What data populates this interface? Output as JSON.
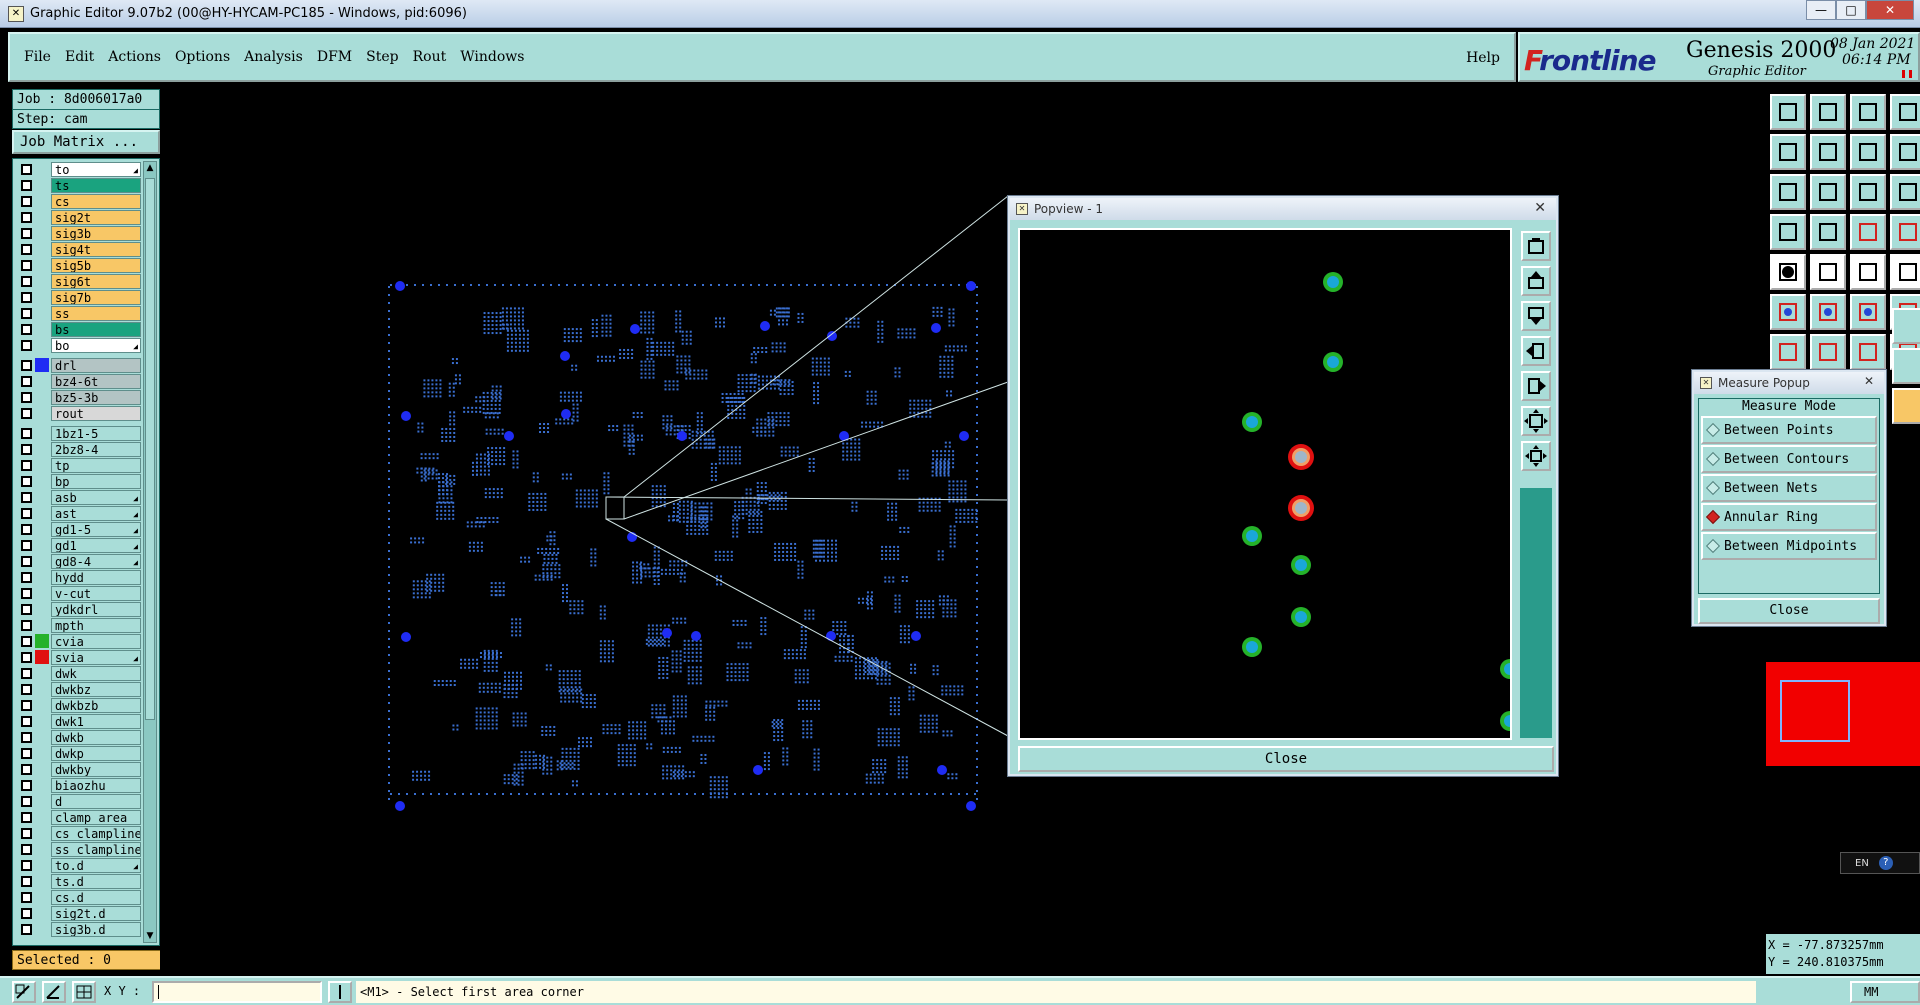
{
  "window": {
    "title": "Graphic Editor 9.07b2 (00@HY-HYCAM-PC185 - Windows, pid:6096)",
    "minimize": "—",
    "maximize": "□",
    "close": "✕"
  },
  "menu": {
    "items": [
      "File",
      "Edit",
      "Actions",
      "Options",
      "Analysis",
      "DFM",
      "Step",
      "Rout",
      "Windows"
    ],
    "help": "Help"
  },
  "brand": {
    "logo_f": "F",
    "logo_rest": "rontline",
    "product": "Genesis 2000",
    "subtitle": "Graphic Editor",
    "date": "08 Jan 2021",
    "time": "06:14 PM"
  },
  "job": {
    "job_label": "Job : 8d006017a0",
    "step_label": "Step: cam",
    "matrix_button": "Job Matrix ..."
  },
  "layers": {
    "group1": [
      {
        "name": "to",
        "color": "#ffffff",
        "mark": true
      },
      {
        "name": "ts",
        "color": "#1aa37f",
        "mark": false
      },
      {
        "name": "cs",
        "color": "#f8c766",
        "mark": false
      },
      {
        "name": "sig2t",
        "color": "#f8c766",
        "mark": false
      },
      {
        "name": "sig3b",
        "color": "#f8c766",
        "mark": false
      },
      {
        "name": "sig4t",
        "color": "#f8c766",
        "mark": false
      },
      {
        "name": "sig5b",
        "color": "#f8c766",
        "mark": false
      },
      {
        "name": "sig6t",
        "color": "#f8c766",
        "mark": false
      },
      {
        "name": "sig7b",
        "color": "#f8c766",
        "mark": false
      },
      {
        "name": "ss",
        "color": "#f8c766",
        "mark": false
      },
      {
        "name": "bs",
        "color": "#1aa37f",
        "mark": false
      },
      {
        "name": "bo",
        "color": "#ffffff",
        "mark": true
      }
    ],
    "group2": [
      {
        "name": "drl",
        "color": "#b3c4c4",
        "swatch": "#1f2cf4"
      },
      {
        "name": "bz4-6t",
        "color": "#b3c4c4",
        "swatch": ""
      },
      {
        "name": "bz5-3b",
        "color": "#b3c4c4",
        "swatch": ""
      },
      {
        "name": "rout",
        "color": "#d8d8d8",
        "swatch": ""
      }
    ],
    "group3": [
      {
        "name": "1bz1-5",
        "mark": false,
        "swatch": ""
      },
      {
        "name": "2bz8-4",
        "mark": false,
        "swatch": ""
      },
      {
        "name": "tp",
        "mark": false,
        "swatch": ""
      },
      {
        "name": "bp",
        "mark": false,
        "swatch": ""
      },
      {
        "name": "asb",
        "mark": true,
        "swatch": ""
      },
      {
        "name": "ast",
        "mark": true,
        "swatch": ""
      },
      {
        "name": "gd1-5",
        "mark": true,
        "swatch": ""
      },
      {
        "name": "gd1",
        "mark": true,
        "swatch": ""
      },
      {
        "name": "gd8-4",
        "mark": true,
        "swatch": ""
      },
      {
        "name": "hydd",
        "mark": false,
        "swatch": ""
      },
      {
        "name": "v-cut",
        "mark": false,
        "swatch": ""
      },
      {
        "name": "ydkdrl",
        "mark": false,
        "swatch": ""
      },
      {
        "name": "mpth",
        "mark": false,
        "swatch": ""
      },
      {
        "name": "cvia",
        "mark": false,
        "swatch": "#25b22a"
      },
      {
        "name": "svia",
        "mark": true,
        "swatch": "#e01010"
      },
      {
        "name": "dwk",
        "mark": false,
        "swatch": ""
      },
      {
        "name": "dwkbz",
        "mark": false,
        "swatch": ""
      },
      {
        "name": "dwkbzb",
        "mark": false,
        "swatch": ""
      },
      {
        "name": "dwk1",
        "mark": false,
        "swatch": ""
      },
      {
        "name": "dwkb",
        "mark": false,
        "swatch": ""
      },
      {
        "name": "dwkp",
        "mark": false,
        "swatch": ""
      },
      {
        "name": "dwkby",
        "mark": false,
        "swatch": ""
      },
      {
        "name": "biaozhu",
        "mark": false,
        "swatch": ""
      },
      {
        "name": "d",
        "mark": false,
        "swatch": ""
      },
      {
        "name": "clamp_area",
        "mark": false,
        "swatch": ""
      },
      {
        "name": "cs_clampline",
        "mark": false,
        "swatch": ""
      },
      {
        "name": "ss_clampline",
        "mark": false,
        "swatch": ""
      },
      {
        "name": "to.d",
        "mark": true,
        "swatch": ""
      },
      {
        "name": "ts.d",
        "mark": false,
        "swatch": ""
      },
      {
        "name": "cs.d",
        "mark": false,
        "swatch": ""
      },
      {
        "name": "sig2t.d",
        "mark": false,
        "swatch": ""
      },
      {
        "name": "sig3b.d",
        "mark": false,
        "swatch": ""
      }
    ],
    "selected": "Selected : 0"
  },
  "popview": {
    "title": "Popview - 1",
    "close_x": "✕",
    "close_button": "Close"
  },
  "measure": {
    "title": "Measure Popup",
    "close_x": "✕",
    "mode_label": "Measure Mode",
    "options": [
      {
        "label": "Between Points",
        "active": false
      },
      {
        "label": "Between Contours",
        "active": false
      },
      {
        "label": "Between Nets",
        "active": false
      },
      {
        "label": "Annular Ring",
        "active": true
      },
      {
        "label": "Between Midpoints",
        "active": false
      }
    ],
    "close_button": "Close"
  },
  "ime": {
    "lang": "EN",
    "help": "?"
  },
  "coordinates": {
    "x": "X = -77.873257mm",
    "y": "Y = 240.810375mm"
  },
  "status": {
    "xy_label": "X Y :",
    "message": "<M1> - Select first area corner",
    "units": "MM"
  },
  "colors": {
    "panel": "#a9ddd8",
    "signal_layer": "#f8c766",
    "mask_layer": "#1aa37f",
    "pad_blue": "#2f6fd1",
    "via_green": "#25b22a",
    "via_red": "#e01010"
  }
}
